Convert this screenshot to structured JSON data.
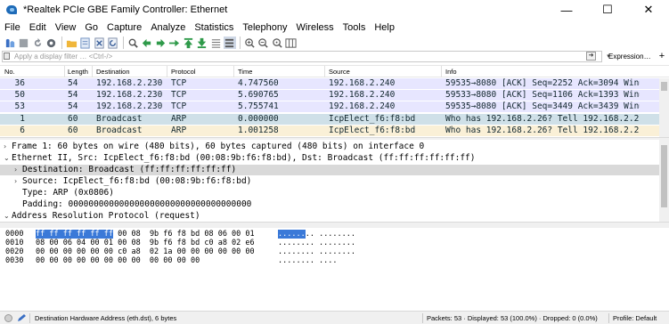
{
  "window": {
    "title": "*Realtek PCIe GBE Family Controller: Ethernet",
    "minimize": "—",
    "maximize": "☐",
    "close": "✕"
  },
  "menu": [
    "File",
    "Edit",
    "View",
    "Go",
    "Capture",
    "Analyze",
    "Statistics",
    "Telephony",
    "Wireless",
    "Tools",
    "Help"
  ],
  "toolbar_icons": [
    "start-capture-icon",
    "stop-capture-icon",
    "restart-capture-icon",
    "capture-options-icon",
    "open-file-icon",
    "save-file-icon",
    "close-file-icon",
    "reload-file-icon",
    "find-packet-icon",
    "go-back-icon",
    "go-forward-icon",
    "go-to-packet-icon",
    "go-first-icon",
    "go-last-icon",
    "auto-scroll-icon",
    "colorize-icon",
    "zoom-in-icon",
    "zoom-out-icon",
    "zoom-normal-icon",
    "resize-columns-icon"
  ],
  "filter": {
    "placeholder": "Apply a display filter … <Ctrl-/>",
    "expression_label": "Expression…",
    "add_label": "+"
  },
  "packet_list": {
    "columns": [
      "No.",
      "Length",
      "Destination",
      "Protocol",
      "Time",
      "Source",
      "Info"
    ],
    "rows": [
      {
        "no": "36",
        "length": "54",
        "destination": "192.168.2.230",
        "protocol": "TCP",
        "time": "4.747560",
        "source": "192.168.2.240",
        "info": "59535→8080 [ACK] Seq=2252 Ack=3094 Win=…",
        "bg": "#e7e6ff",
        "fg": "#12272e"
      },
      {
        "no": "50",
        "length": "54",
        "destination": "192.168.2.230",
        "protocol": "TCP",
        "time": "5.690765",
        "source": "192.168.2.240",
        "info": "59533→8080 [ACK] Seq=1106 Ack=1393 Win=…",
        "bg": "#e7e6ff",
        "fg": "#12272e"
      },
      {
        "no": "53",
        "length": "54",
        "destination": "192.168.2.230",
        "protocol": "TCP",
        "time": "5.755741",
        "source": "192.168.2.240",
        "info": "59535→8080 [ACK] Seq=3449 Ack=3439 Win=…",
        "bg": "#e7e6ff",
        "fg": "#12272e"
      },
      {
        "no": "1",
        "length": "60",
        "destination": "Broadcast",
        "protocol": "ARP",
        "time": "0.000000",
        "source": "IcpElect_f6:f8:bd",
        "info": "Who has 192.168.2.26? Tell 192.168.2.230",
        "bg": "#cfe0e8",
        "fg": "#12272e"
      },
      {
        "no": "6",
        "length": "60",
        "destination": "Broadcast",
        "protocol": "ARP",
        "time": "1.001258",
        "source": "IcpElect_f6:f8:bd",
        "info": "Who has 192.168.2.26? Tell 192.168.2.230",
        "bg": "#faf0d7",
        "fg": "#12272e"
      }
    ]
  },
  "details": [
    {
      "arrow": "›",
      "indent": 0,
      "text": "Frame 1: 60 bytes on wire (480 bits), 60 bytes captured (480 bits) on interface 0",
      "selected": false
    },
    {
      "arrow": "⌄",
      "indent": 0,
      "text": "Ethernet II, Src: IcpElect_f6:f8:bd (00:08:9b:f6:f8:bd), Dst: Broadcast (ff:ff:ff:ff:ff:ff)",
      "selected": false
    },
    {
      "arrow": "›",
      "indent": 1,
      "text": "Destination: Broadcast (ff:ff:ff:ff:ff:ff)",
      "selected": true
    },
    {
      "arrow": "›",
      "indent": 1,
      "text": "Source: IcpElect_f6:f8:bd (00:08:9b:f6:f8:bd)",
      "selected": false
    },
    {
      "arrow": "",
      "indent": 1,
      "text": "Type: ARP (0x0806)",
      "selected": false
    },
    {
      "arrow": "",
      "indent": 1,
      "text": "Padding: 000000000000000000000000000000000000",
      "selected": false
    },
    {
      "arrow": "⌄",
      "indent": 0,
      "text": "Address Resolution Protocol (request)",
      "selected": false
    }
  ],
  "bytes": [
    {
      "offset": "0000",
      "hex_sel": "ff ff ff ff ff ff",
      "hex_rest": " 00 08  9b f6 f8 bd 08 06 00 01",
      "ascii_sel": "......",
      "ascii_rest": ".. ........"
    },
    {
      "offset": "0010",
      "hex_sel": "",
      "hex_rest": "08 00 06 04 00 01 00 08  9b f6 f8 bd c0 a8 02 e6",
      "ascii_sel": "",
      "ascii_rest": "........ ........"
    },
    {
      "offset": "0020",
      "hex_sel": "",
      "hex_rest": "00 00 00 00 00 00 c0 a8  02 1a 00 00 00 00 00 00",
      "ascii_sel": "",
      "ascii_rest": "........ ........"
    },
    {
      "offset": "0030",
      "hex_sel": "",
      "hex_rest": "00 00 00 00 00 00 00 00  00 00 00 00",
      "ascii_sel": "",
      "ascii_rest": "........ ...."
    }
  ],
  "status": {
    "field": "Destination Hardware Address (eth.dst), 6 bytes",
    "packets": "Packets: 53 · Displayed: 53 (100.0%) · Dropped: 0 (0.0%)",
    "profile": "Profile: Default"
  },
  "colors": {
    "selection": "#3a79d8",
    "tcp_row": "#e7e6ff",
    "arp_selected_row": "#cfe0e8",
    "arp_row": "#faf0d7"
  }
}
